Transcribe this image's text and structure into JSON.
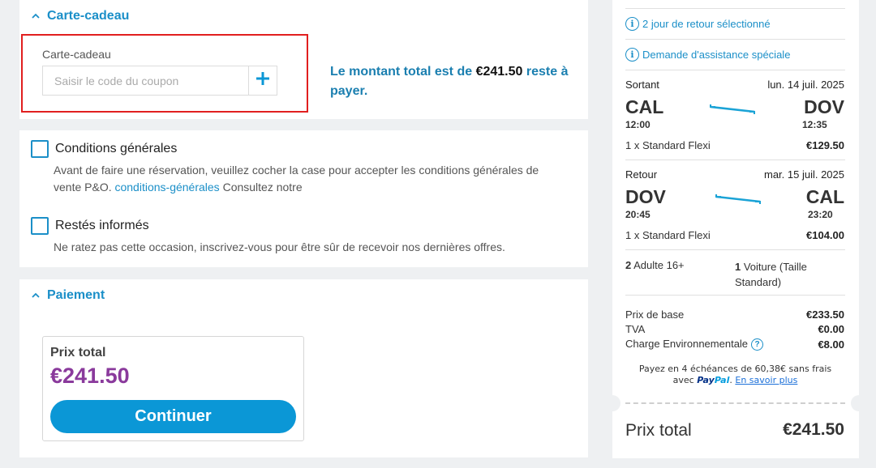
{
  "gift_card": {
    "section_title": "Carte-cadeau",
    "field_label": "Carte-cadeau",
    "input_placeholder": "Saisir le code du coupon",
    "input_value": "",
    "total_prefix": "Le montant total est de ",
    "total_amount": "€241.50",
    "total_suffix": " reste à",
    "total_line2": "payer."
  },
  "terms": {
    "title": "Conditions générales",
    "desc_line1": "Avant de faire une réservation, veuillez cocher la case pour accepter les conditions générales de",
    "desc_line2_prefix": "vente P&O. ",
    "link_text": "conditions-générales",
    "desc_line2_suffix": " Consultez notre",
    "checked": false
  },
  "newsletter": {
    "title": "Restés informés",
    "desc": "Ne ratez pas cette occasion, inscrivez-vous pour être sûr de recevoir nos dernières offres.",
    "checked": false
  },
  "payment": {
    "section_title": "Paiement",
    "total_label": "Prix total",
    "total_amount": "€241.50",
    "continue_label": "Continuer"
  },
  "summary": {
    "return_selected": "2 jour de retour sélectionné",
    "special_assistance": "Demande d'assistance spéciale",
    "outbound": {
      "label": "Sortant",
      "date": "lun. 14 juil. 2025",
      "from": "CAL",
      "to": "DOV",
      "depart": "12:00",
      "arrive": "12:35",
      "fare": "1 x Standard Flexi",
      "price": "€129.50"
    },
    "inbound": {
      "label": "Retour",
      "date": "mar. 15 juil. 2025",
      "from": "DOV",
      "to": "CAL",
      "depart": "20:45",
      "arrive": "23:20",
      "fare": "1 x Standard Flexi",
      "price": "€104.00"
    },
    "passengers_count": "2",
    "passengers_text": " Adulte 16+",
    "vehicle_count": "1",
    "vehicle_text_line1": " Voiture (Taille",
    "vehicle_text_line2": "Standard)",
    "base_price_label": "Prix de base",
    "base_price": "€233.50",
    "vat_label": "TVA",
    "vat": "€0.00",
    "eco_label": "Charge Environnementale",
    "eco": "€8.00",
    "paypal_line1": "Payez en 4 échéances de 60,38€ sans frais",
    "paypal_with": "avec ",
    "paypal_brand1": "Pay",
    "paypal_brand2": "Pal",
    "paypal_link": "En savoir plus",
    "total_label": "Prix total",
    "total": "€241.50"
  },
  "colors": {
    "accent": "#1b8fc8",
    "price_purple": "#8a3a9c",
    "button_blue": "#0b97d6",
    "highlight_red": "#e11f1f"
  }
}
